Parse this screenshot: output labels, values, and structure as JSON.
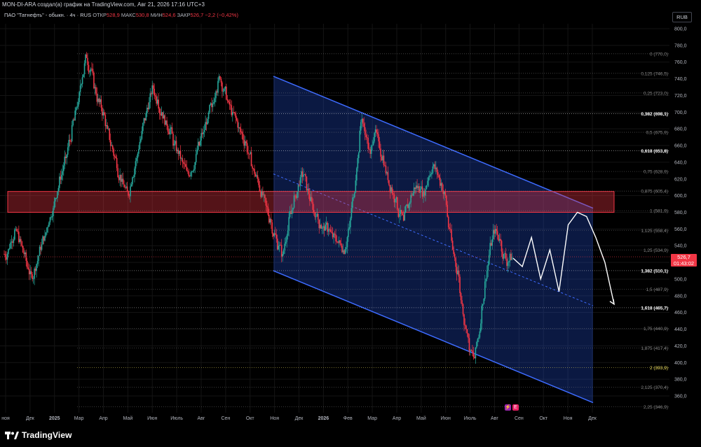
{
  "header": {
    "title": "MON-DI-ARA создал(а) график на TradingView.com, Авг 21, 2026 17:16 UTC+3"
  },
  "legend": {
    "symbol": "ПАО \"Татнефть\" - обыкн. · 4ч · RUS",
    "open_label": "ОТКР",
    "open_value": "528,9",
    "high_label": "МАКС",
    "high_value": "530,8",
    "low_label": "МИН",
    "low_value": "524,6",
    "close_label": "ЗАКР",
    "close_value": "526,7",
    "change": "−2,2 (−0,42%)"
  },
  "currency": "RUB",
  "price_tag": {
    "price": "526,7",
    "countdown": "01:43:02"
  },
  "colors": {
    "up": "#26a69a",
    "down": "#f23645",
    "channel": "#2962ff",
    "zone": "#f23645"
  },
  "icons": [
    "tradingview-logo-icon",
    "lightning-event-icon",
    "earnings-event-icon"
  ],
  "brand": {
    "name": "TradingView"
  },
  "events": {
    "dividend": "⚡",
    "earnings": "E"
  },
  "chart_data": {
    "type": "candlestick",
    "timeframe": "4ч",
    "y_axis": {
      "ticks": [
        360,
        380,
        400,
        420,
        440,
        460,
        480,
        500,
        520,
        540,
        560,
        580,
        600,
        620,
        640,
        660,
        680,
        700,
        720,
        740,
        760,
        780,
        800
      ],
      "tick_labels": [
        "360,0",
        "380,0",
        "400,0",
        "420,0",
        "440,0",
        "460,0",
        "480,0",
        "500,0",
        "520,0",
        "540,0",
        "560,0",
        "580,0",
        "600,0",
        "620,0",
        "640,0",
        "660,0",
        "680,0",
        "700,0",
        "720,0",
        "740,0",
        "760,0",
        "780,0",
        "800,0"
      ],
      "range": [
        345,
        815
      ]
    },
    "x_axis": {
      "labels": [
        "ноя",
        "Дек",
        "2025",
        "Мар",
        "Апр",
        "Май",
        "Июн",
        "Июль",
        "Авг",
        "Сен",
        "Окт",
        "Ноя",
        "Дек",
        "2026",
        "Фев",
        "Мар",
        "Апр",
        "Май",
        "Июн",
        "Июль",
        "Авг",
        "Сен",
        "Окт",
        "Ноя",
        "Дек"
      ],
      "bold": [
        "2025",
        "2026"
      ]
    },
    "fib_levels": [
      {
        "label": "0 (770,0)",
        "price": 770.0,
        "style": "dotted",
        "bold": false,
        "color": "#888888"
      },
      {
        "label": "0,125 (746,5)",
        "price": 746.5,
        "style": "dotted",
        "bold": false,
        "color": "#888888"
      },
      {
        "label": "0,25 (723,0)",
        "price": 723.0,
        "style": "dotted",
        "bold": false,
        "color": "#888888"
      },
      {
        "label": "0,382 (698,1)",
        "price": 698.1,
        "style": "dotted",
        "bold": true,
        "color": "#ffffff"
      },
      {
        "label": "0,5 (675,9)",
        "price": 675.9,
        "style": "dotted",
        "bold": false,
        "color": "#888888"
      },
      {
        "label": "0,618 (653,8)",
        "price": 653.8,
        "style": "dotted",
        "bold": true,
        "color": "#ffffff"
      },
      {
        "label": "0,75 (628,9)",
        "price": 628.9,
        "style": "dotted",
        "bold": false,
        "color": "#888888"
      },
      {
        "label": "0,875 (605,4)",
        "price": 605.4,
        "style": "dotted",
        "bold": false,
        "color": "#888888"
      },
      {
        "label": "1 (581,9)",
        "price": 581.9,
        "style": "dotted",
        "bold": false,
        "color": "#888888"
      },
      {
        "label": "1,125 (558,4)",
        "price": 558.4,
        "style": "dotted",
        "bold": false,
        "color": "#888888"
      },
      {
        "label": "1,25 (534,9)",
        "price": 534.9,
        "style": "dotted",
        "bold": false,
        "color": "#888888"
      },
      {
        "label": "1,382 (510,1)",
        "price": 510.1,
        "style": "dotted",
        "bold": true,
        "color": "#ffffff"
      },
      {
        "label": "1,5 (487,9)",
        "price": 487.9,
        "style": "dotted",
        "bold": false,
        "color": "#888888"
      },
      {
        "label": "1,618 (465,7)",
        "price": 465.7,
        "style": "dotted",
        "bold": true,
        "color": "#ffffff"
      },
      {
        "label": "1,75 (440,9)",
        "price": 440.9,
        "style": "dotted",
        "bold": false,
        "color": "#888888"
      },
      {
        "label": "1,875 (417,4)",
        "price": 417.4,
        "style": "dotted",
        "bold": false,
        "color": "#888888"
      },
      {
        "label": "2 (393,9)",
        "price": 393.9,
        "style": "dotted",
        "bold": false,
        "color": "#f5e663"
      },
      {
        "label": "2,125 (370,4)",
        "price": 370.4,
        "style": "dotted",
        "bold": false,
        "color": "#888888"
      },
      {
        "label": "2,25 (346,9)",
        "price": 346.9,
        "style": "dotted",
        "bold": false,
        "color": "#888888"
      }
    ],
    "resistance_zone": {
      "price_top": 605,
      "price_bottom": 580
    },
    "regression_channel": {
      "upper_start_price": 743,
      "upper_end_price": 585,
      "lower_start_price": 510,
      "lower_end_price": 352,
      "mid_start_price": 626,
      "mid_end_price": 468
    },
    "price_path_close": [
      530,
      545,
      560,
      548,
      530,
      512,
      500,
      518,
      535,
      552,
      568,
      585,
      605,
      625,
      645,
      665,
      690,
      712,
      742,
      765,
      752,
      730,
      712,
      700,
      680,
      660,
      645,
      625,
      610,
      600,
      622,
      645,
      668,
      690,
      712,
      728,
      715,
      700,
      690,
      680,
      662,
      650,
      640,
      630,
      628,
      640,
      660,
      676,
      692,
      706,
      725,
      740,
      728,
      712,
      700,
      690,
      676,
      665,
      650,
      632,
      620,
      605,
      588,
      572,
      555,
      540,
      530,
      552,
      578,
      600,
      612,
      625,
      608,
      592,
      575,
      565,
      558,
      560,
      550,
      545,
      540,
      536,
      562,
      598,
      645,
      692,
      670,
      650,
      675,
      665,
      648,
      628,
      610,
      596,
      578,
      570,
      585,
      600,
      612,
      608,
      600,
      622,
      635,
      628,
      615,
      600,
      560,
      530,
      510,
      470,
      440,
      415,
      405,
      430,
      470,
      510,
      540,
      560,
      548,
      530,
      520,
      526.7
    ],
    "projection_path": [
      525,
      515,
      550,
      500,
      535,
      485,
      565,
      580,
      575,
      550,
      520,
      470
    ]
  }
}
